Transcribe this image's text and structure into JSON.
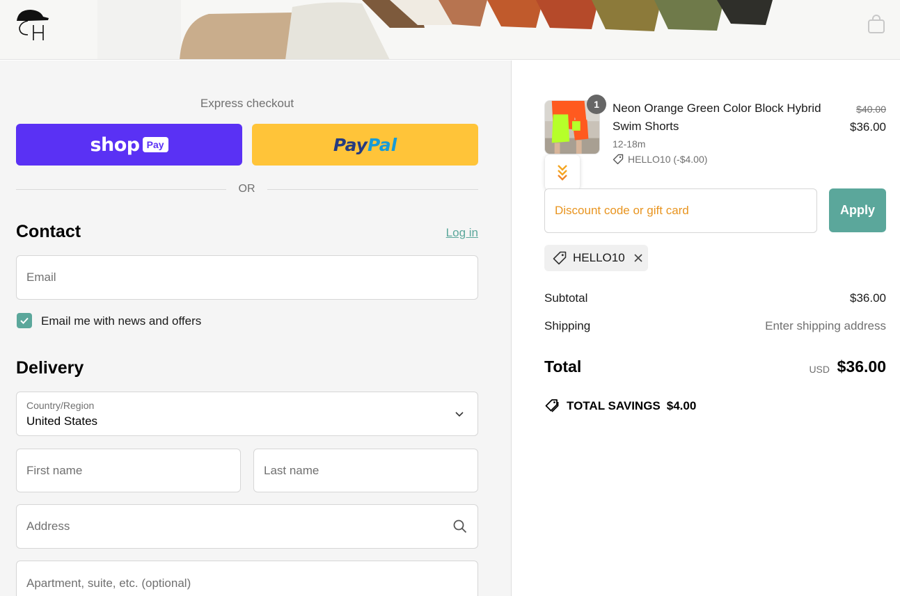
{
  "header": {
    "logo_alt": "GH",
    "cart_icon": "shopping-bag-icon"
  },
  "express": {
    "label": "Express checkout",
    "shop_pay": {
      "word": "shop",
      "pay": "Pay"
    },
    "paypal": {
      "part1": "Pay",
      "part2": "Pal"
    },
    "or": "OR"
  },
  "contact": {
    "title": "Contact",
    "login": "Log in",
    "email_placeholder": "Email",
    "newsletter_label": "Email me with news and offers",
    "newsletter_checked": true
  },
  "delivery": {
    "title": "Delivery",
    "country_label": "Country/Region",
    "country_value": "United States",
    "first_name_placeholder": "First name",
    "last_name_placeholder": "Last name",
    "address_placeholder": "Address",
    "apartment_placeholder": "Apartment, suite, etc. (optional)"
  },
  "summary": {
    "item": {
      "quantity": "1",
      "name": "Neon Orange Green Color Block Hybrid Swim Shorts",
      "variant": "12-18m",
      "discount": "HELLO10 (-$4.00)",
      "price_original": "$40.00",
      "price": "$36.00"
    },
    "discount_placeholder": "Discount code or gift card",
    "apply_label": "Apply",
    "applied_code": "HELLO10",
    "subtotal_label": "Subtotal",
    "subtotal_value": "$36.00",
    "shipping_label": "Shipping",
    "shipping_value": "Enter shipping address",
    "total_label": "Total",
    "total_currency": "USD",
    "total_value": "$36.00",
    "savings_label": "TOTAL SAVINGS",
    "savings_value": "$4.00"
  },
  "colors": {
    "accent": "#5ba79b",
    "shop_pay": "#5a31f4",
    "paypal": "#ffc439",
    "discount_placeholder": "#e8941f"
  }
}
